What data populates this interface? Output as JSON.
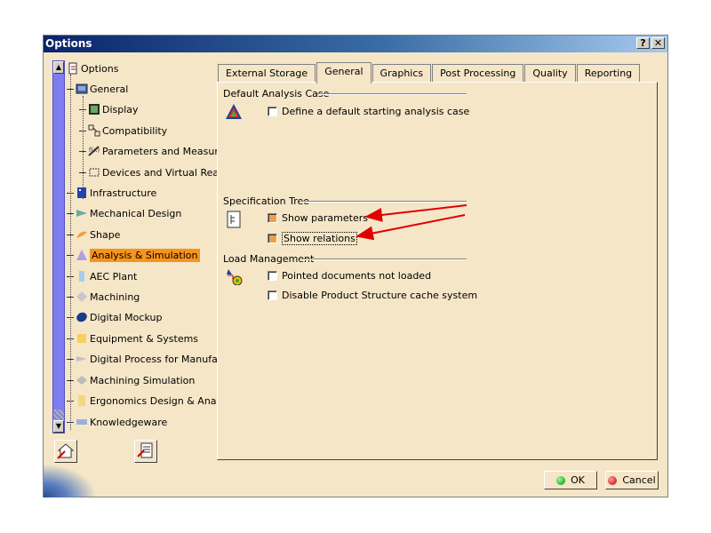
{
  "window": {
    "title": "Options",
    "help_label": "?",
    "close_label": "✕"
  },
  "tree": {
    "items": [
      {
        "label": "Options",
        "icon": "options-icon"
      },
      {
        "label": "General",
        "icon": "general-icon"
      },
      {
        "label": "Display",
        "icon": "display-icon"
      },
      {
        "label": "Compatibility",
        "icon": "compatibility-icon"
      },
      {
        "label": "Parameters and Measure",
        "icon": "parameters-icon"
      },
      {
        "label": "Devices and Virtual Reality",
        "icon": "devices-icon"
      },
      {
        "label": "Infrastructure",
        "icon": "infrastructure-icon"
      },
      {
        "label": "Mechanical Design",
        "icon": "mechanical-design-icon"
      },
      {
        "label": "Shape",
        "icon": "shape-icon"
      },
      {
        "label": "Analysis & Simulation",
        "icon": "analysis-icon",
        "selected": true
      },
      {
        "label": "AEC Plant",
        "icon": "aec-plant-icon"
      },
      {
        "label": "Machining",
        "icon": "machining-icon"
      },
      {
        "label": "Digital Mockup",
        "icon": "digital-mockup-icon"
      },
      {
        "label": "Equipment & Systems",
        "icon": "equipment-icon"
      },
      {
        "label": "Digital Process for Manufact",
        "icon": "digital-process-icon"
      },
      {
        "label": "Machining Simulation",
        "icon": "machining-simulation-icon"
      },
      {
        "label": "Ergonomics Design & Analys",
        "icon": "ergonomics-icon"
      },
      {
        "label": "Knowledgeware",
        "icon": "knowledgeware-icon"
      }
    ]
  },
  "tabs": [
    {
      "label": "External Storage"
    },
    {
      "label": "General",
      "active": true
    },
    {
      "label": "Graphics"
    },
    {
      "label": "Post Processing"
    },
    {
      "label": "Quality"
    },
    {
      "label": "Reporting"
    }
  ],
  "groups": {
    "default_case": {
      "title": "Default Analysis Case",
      "options": [
        {
          "label": "Define a default starting analysis case",
          "checked": false
        }
      ]
    },
    "spec_tree": {
      "title": "Specification Tree",
      "options": [
        {
          "label": "Show parameters",
          "checked": true
        },
        {
          "label": "Show relations",
          "checked": true
        }
      ]
    },
    "load_mgmt": {
      "title": "Load Management",
      "options": [
        {
          "label": "Pointed documents not loaded",
          "checked": false
        },
        {
          "label": "Disable Product Structure cache system",
          "checked": false
        }
      ]
    }
  },
  "buttons": {
    "ok": "OK",
    "cancel": "Cancel"
  },
  "colors": {
    "background": "#f5e6c8",
    "selection": "#f7941d",
    "annotation_arrow": "#e00000",
    "title_bar": "#0a246a"
  }
}
